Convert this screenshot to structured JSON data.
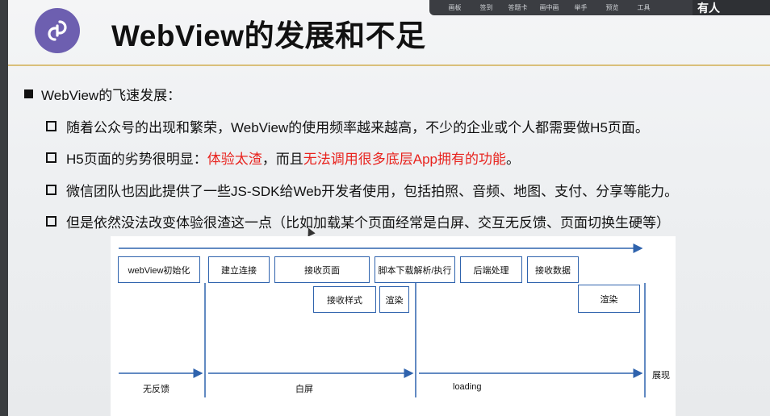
{
  "toolbar": {
    "items": [
      "画板",
      "签到",
      "答题卡",
      "画中画",
      "举手",
      "预览",
      "工具"
    ],
    "right_label": "有人"
  },
  "slide": {
    "title": "WebView的发展和不足",
    "main_bullet": "WebView的飞速发展：",
    "bullets": [
      {
        "text": "随着公众号的出现和繁荣，WebView的使用频率越来越高，不少的企业或个人都需要做H5页面。"
      },
      {
        "prefix": "H5页面的劣势很明显：",
        "red1": "体验太渣",
        "middle": "，而且",
        "red2": "无法调用很多底层App拥有的功能",
        "suffix": "。"
      },
      {
        "text": "微信团队也因此提供了一些JS-SDK给Web开发者使用，包括拍照、音频、地图、支付、分享等能力。"
      },
      {
        "text": "但是依然没法改变体验很渣这一点（比如加载某个页面经常是白屏、交互无反馈、页面切换生硬等）"
      }
    ]
  },
  "diagram": {
    "boxes": {
      "init": "webView初始化",
      "connect": "建立连接",
      "receive_page": "接收页面",
      "script": "脚本下载解析/执行",
      "backend": "后端处理",
      "receive_data": "接收数据",
      "receive_style": "接收样式",
      "render1": "渲染",
      "render2": "渲染"
    },
    "phases": {
      "no_feedback": "无反馈",
      "white_screen": "白屏",
      "loading": "loading",
      "show": "展现"
    }
  },
  "colors": {
    "accent_line": "#2f63ad",
    "red_text": "#e8231e",
    "logo_bg": "#6d5fb0",
    "header_rule": "#d9bf7a"
  }
}
